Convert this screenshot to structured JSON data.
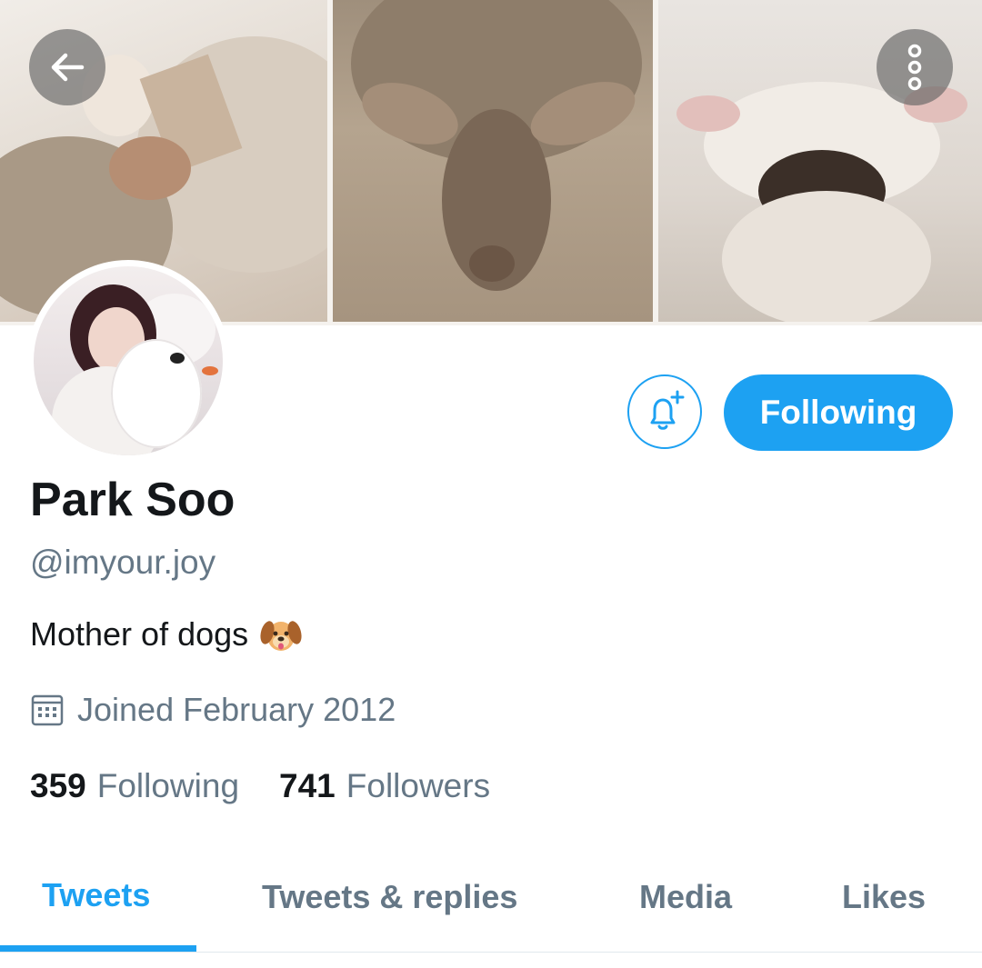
{
  "profile": {
    "name": "Park Soo",
    "handle": "@imyour.joy",
    "bio": "Mother of dogs",
    "bio_emoji": "dog-face-emoji",
    "joined": "Joined February 2012"
  },
  "actions": {
    "follow_label": "Following",
    "notify_icon": "bell-plus-icon"
  },
  "stats": {
    "following_count": "359",
    "following_label": "Following",
    "followers_count": "741",
    "followers_label": "Followers"
  },
  "tabs": [
    {
      "label": "Tweets",
      "active": true
    },
    {
      "label": "Tweets & replies",
      "active": false
    },
    {
      "label": "Media",
      "active": false
    },
    {
      "label": "Likes",
      "active": false
    }
  ],
  "icons": {
    "back": "back-arrow-icon",
    "more": "more-vertical-icon",
    "calendar": "calendar-icon"
  },
  "colors": {
    "accent": "#1da1f2",
    "secondary_text": "#657786",
    "primary_text": "#14171a"
  }
}
